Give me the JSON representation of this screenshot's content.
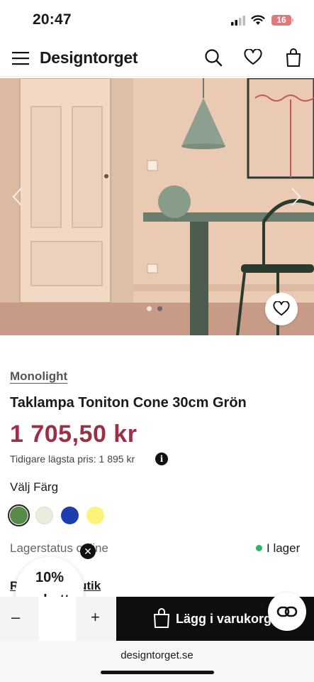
{
  "status": {
    "time": "20:47",
    "battery": "16"
  },
  "header": {
    "brand": "Designtorget"
  },
  "product": {
    "brand": "Monolight",
    "title": "Taklampa Toniton Cone 30cm Grön",
    "price": "1 705,50 kr",
    "previous_price": "Tidigare lägsta pris: 1 895 kr",
    "color_label": "Välj Färg",
    "colors": [
      "#5a8a4a",
      "#ecebdc",
      "#1c3fb0",
      "#fff27a"
    ],
    "stock_label": "Lagerstatus online",
    "stock_status": "I lager",
    "reserve_left": "R",
    "reserve_right": "utik",
    "hero_images_total": 2,
    "hero_image_active": 2
  },
  "promo": {
    "line1": "10%",
    "line2": "rabatt"
  },
  "cart": {
    "minus": "–",
    "plus": "+",
    "add_label": "Lägg i varukorgen"
  },
  "browser": {
    "url": "designtorget.se"
  },
  "colors": {
    "price": "#9b2f45",
    "in_stock": "#2eb36a",
    "cta_bg": "#0f0f0f"
  }
}
